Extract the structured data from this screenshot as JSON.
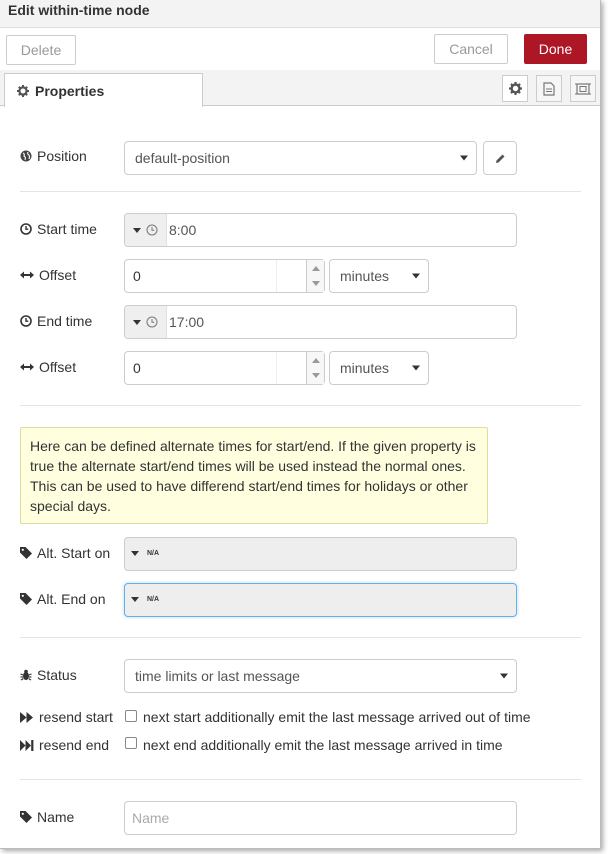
{
  "tray": {
    "title": "Edit within-time node",
    "delete_label": "Delete",
    "cancel_label": "Cancel",
    "done_label": "Done",
    "accent_color": "#ad1625"
  },
  "tabs": {
    "active_label": "Properties",
    "icon_buttons": [
      "gear-icon",
      "document-icon",
      "frame-icon"
    ]
  },
  "form": {
    "position": {
      "label": "Position",
      "value": "default-position"
    },
    "start_time": {
      "label": "Start time",
      "value": "8:00"
    },
    "start_offset": {
      "label": "Offset",
      "value": "0",
      "unit": "minutes"
    },
    "end_time": {
      "label": "End time",
      "value": "17:00"
    },
    "end_offset": {
      "label": "Offset",
      "value": "0",
      "unit": "minutes"
    },
    "tip": "Here can be defined alternate times for start/end. If the given property is true the alternate start/end times will be used instead the normal ones. This can be used to have differend start/end times for holidays or other special days.",
    "alt_start": {
      "label": "Alt. Start on",
      "value": "N/A"
    },
    "alt_end": {
      "label": "Alt. End on",
      "value": "N/A"
    },
    "status": {
      "label": "Status",
      "value": "time limits or last message"
    },
    "resend_start": {
      "label": "resend start",
      "text": "next start additionally emit the last message arrived out of time",
      "checked": false
    },
    "resend_end": {
      "label": "resend end",
      "text": "next end additionally emit the last message arrived in time",
      "checked": false
    },
    "name": {
      "label": "Name",
      "placeholder": "Name",
      "value": ""
    }
  }
}
